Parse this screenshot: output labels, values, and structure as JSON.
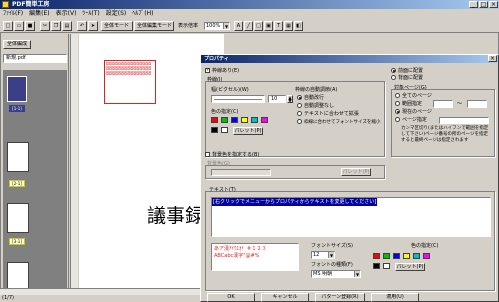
{
  "app": {
    "title": "PDF簡単工房"
  },
  "menu": [
    "ﾌｧｲﾙ(F)",
    "編集(E)",
    "表示(V)",
    "ﾂｰﾙ(T)",
    "設定(S)",
    "ﾍﾙﾌﾟ(H)"
  ],
  "toolbar": {
    "mode1": "全体モード",
    "mode2": "全体編集モード",
    "zoom_label": "表示倍率",
    "zoom_value": "100%"
  },
  "sidebar": {
    "header": "全体編成",
    "file_name": "新規.pdf",
    "page_labels": [
      "[1-1]",
      "[2-1]",
      "[3-1]"
    ]
  },
  "canvas": {
    "sample_line": "888888888888888",
    "big_text": "議事録"
  },
  "status": "(1/7)",
  "dialog": {
    "title": "プロパティ",
    "frame_checkbox": "枠線あり(E)",
    "frame_group": "枠線(I)",
    "width_label": "幅(ピクセル)(W)",
    "width_value": "10",
    "autowrap_label": "枠線の自動調節(A)",
    "autowrap_options": [
      "自動改行",
      "自動調整なし",
      "テキストに合わせて拡張",
      "枠線に合わせてフォントサイズを縮小"
    ],
    "color_label": "色の指定(C)",
    "palette_button": "パレット(P)",
    "bg_checkbox": "背景色を指定する(B)",
    "bg_group": "背景色(G)",
    "bg_palette": "パレット(P)",
    "text_group": "テキスト(T)",
    "text_value": "[右クリックでメニューからプロパティからテキストを変更してください]",
    "preview_line1": "あア漢ｱｲｳｴｵ！＃１２３",
    "preview_line2": "ABCabc漢字\"@#%",
    "font_size_label": "フォントサイズ(S)",
    "font_size_value": "12",
    "font_kind_label": "フォントの種類(F)",
    "font_kind_value": "MS 明朝",
    "font_color_label": "色の指定(C)",
    "font_palette": "パレット(P)",
    "placement": [
      "前面に配置",
      "背面に配置"
    ],
    "target_group": "対象ページ(G)",
    "target_options": [
      "全てのページ",
      "範囲指定",
      "現在のページ",
      "ページ指定"
    ],
    "range_sep": "〜",
    "hint": "カンマ区切り(またはハイフンで範囲を指定して下さい)ページ番号の所のページを指定すると最終ページは指定されます",
    "buttons": {
      "ok": "OK",
      "cancel": "キャンセル",
      "pattern": "パターン登録(R)",
      "apply": "適用(U)"
    }
  },
  "colors": {
    "palette": [
      "#ff0000",
      "#00c000",
      "#0000ff",
      "#ffff00",
      "#00c0c0",
      "#ff00ff",
      "#000000",
      "#ffffff"
    ],
    "selection": "#0000a0",
    "accent_red": "#d22"
  }
}
